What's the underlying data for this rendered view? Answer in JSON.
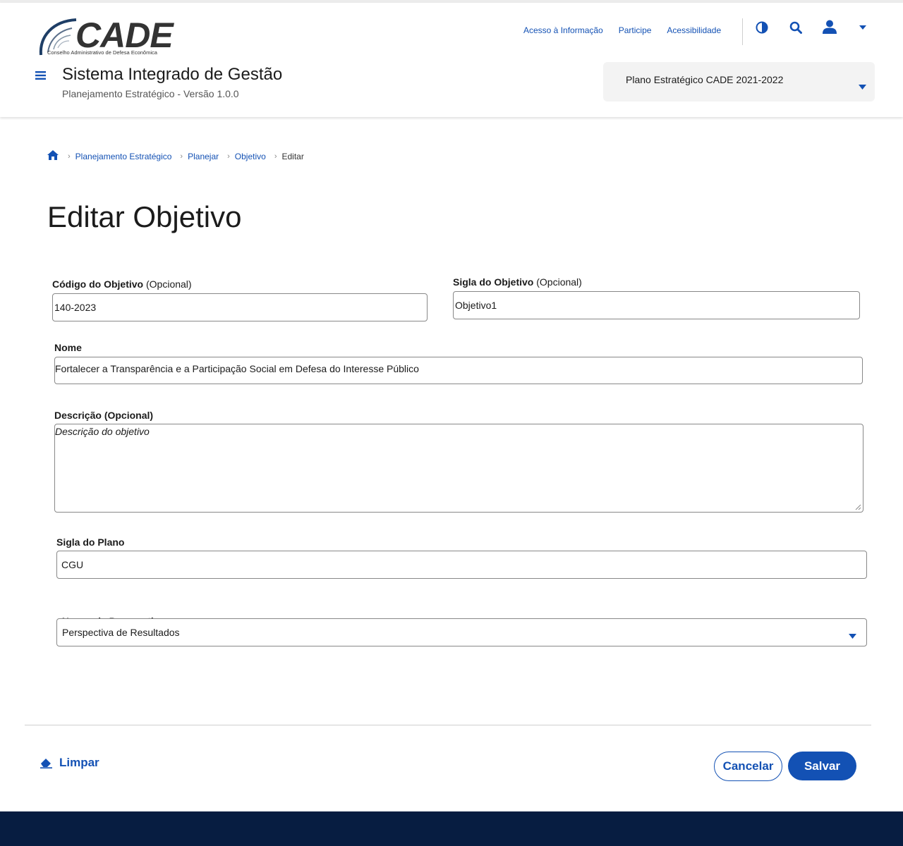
{
  "header": {
    "logo": {
      "word": "CADE",
      "subtitle": "Conselho Administrativo de Defesa Econômica"
    },
    "top_links": [
      "Acesso à Informação",
      "Participe",
      "Acessibilidade"
    ],
    "icons": [
      "contrast-icon",
      "search-icon",
      "user-icon",
      "caret-down-icon"
    ],
    "system_title": "Sistema Integrado de Gestão",
    "system_subtitle": "Planejamento Estratégico - Versão 1.0.0",
    "plan_select": {
      "value": "Plano Estratégico CADE 2021-2022"
    }
  },
  "breadcrumb": {
    "items": [
      "Planejamento Estratégico",
      "Planejar",
      "Objetivo"
    ],
    "current": "Editar"
  },
  "page_title": "Editar Objetivo",
  "form": {
    "codigo": {
      "label": "Código do Objetivo",
      "optional": "(Opcional)",
      "value": "140-2023"
    },
    "sigla": {
      "label": "Sigla do Objetivo",
      "optional": "(Opcional)",
      "value": "Objetivo1"
    },
    "nome": {
      "label": "Nome",
      "value": "Fortalecer a Transparência e a Participação Social em Defesa do Interesse Público"
    },
    "descricao": {
      "label": "Descrição (Opcional)",
      "placeholder": "Descrição do objetivo"
    },
    "sigla_plano": {
      "label": "Sigla do Plano",
      "value": "CGU"
    },
    "perspectiva": {
      "label": "Nome  da Perspectiva",
      "value": "Perspectiva de Resultados"
    }
  },
  "actions": {
    "clear": "Limpar",
    "cancel": "Cancelar",
    "save": "Salvar"
  },
  "colors": {
    "primary": "#1351b4",
    "footer": "#071d41",
    "text": "#1b1b1b"
  }
}
